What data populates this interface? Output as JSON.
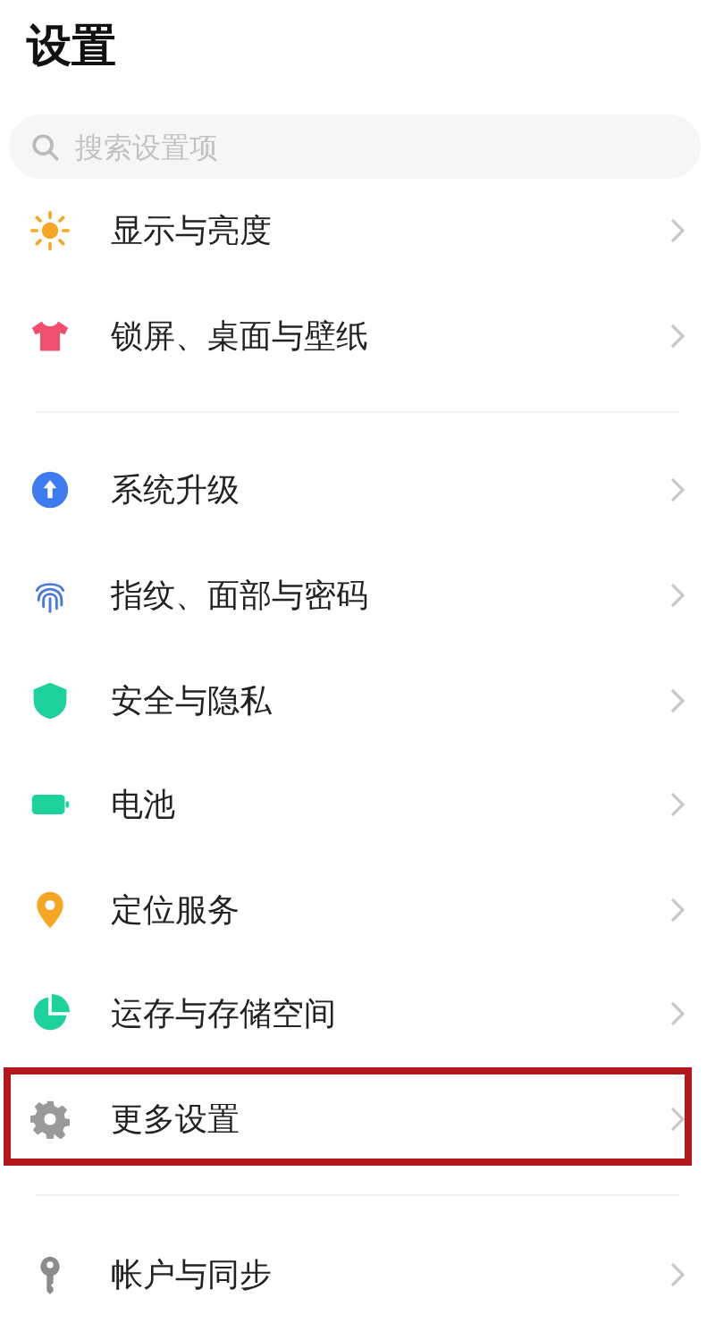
{
  "title": "设置",
  "search": {
    "placeholder": "搜索设置项"
  },
  "groups": [
    {
      "items": [
        {
          "label": "显示与亮度",
          "highlighted": false
        },
        {
          "label": "锁屏、桌面与壁纸",
          "highlighted": false
        }
      ]
    },
    {
      "items": [
        {
          "label": "系统升级",
          "highlighted": false
        },
        {
          "label": "指纹、面部与密码",
          "highlighted": false
        },
        {
          "label": "安全与隐私",
          "highlighted": false
        },
        {
          "label": "电池",
          "highlighted": false
        },
        {
          "label": "定位服务",
          "highlighted": false
        },
        {
          "label": "运存与存储空间",
          "highlighted": false
        },
        {
          "label": "更多设置",
          "highlighted": true
        }
      ]
    },
    {
      "items": [
        {
          "label": "帐户与同步",
          "highlighted": false
        }
      ]
    }
  ]
}
